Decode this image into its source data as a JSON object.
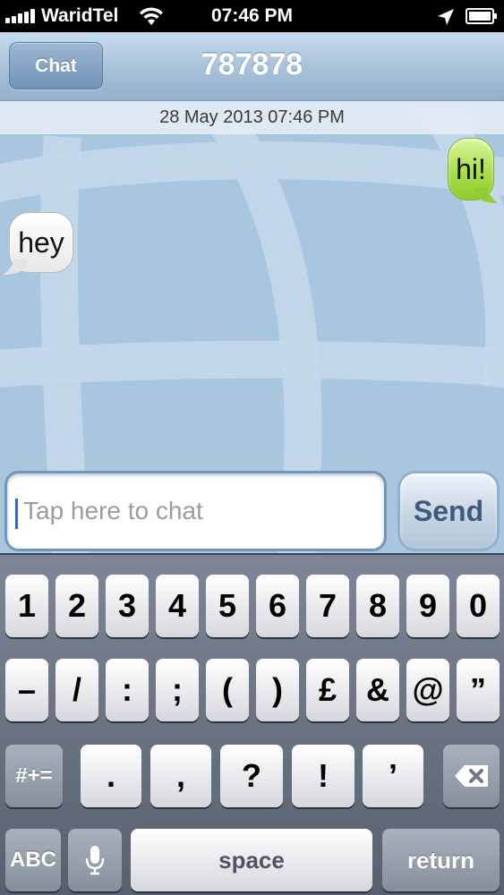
{
  "status_bar": {
    "carrier": "WaridTel",
    "time": "07:46 PM",
    "icons": [
      "signal-bars-icon",
      "wifi-icon",
      "location-arrow-icon",
      "battery-icon"
    ]
  },
  "nav": {
    "back_label": "Chat",
    "title": "787878"
  },
  "chat": {
    "date": "28 May 2013 07:46 PM",
    "messages": [
      {
        "direction": "outgoing",
        "text": "hi!",
        "color": "#a6dc46"
      },
      {
        "direction": "incoming",
        "text": "hey",
        "color": "#ffffff"
      }
    ],
    "input_placeholder": "Tap here to chat",
    "send_label": "Send"
  },
  "keyboard": {
    "row1": [
      "1",
      "2",
      "3",
      "4",
      "5",
      "6",
      "7",
      "8",
      "9",
      "0"
    ],
    "row2": [
      "–",
      "/",
      ":",
      ";",
      "(",
      ")",
      "£",
      "&",
      "@",
      "”"
    ],
    "row3": [
      "#+=",
      ".",
      ",",
      "?",
      "!",
      "’"
    ],
    "delete_icon": "backspace-icon",
    "mode_label": "ABC",
    "mic_icon": "microphone-icon",
    "space_label": "space",
    "return_label": "return"
  }
}
